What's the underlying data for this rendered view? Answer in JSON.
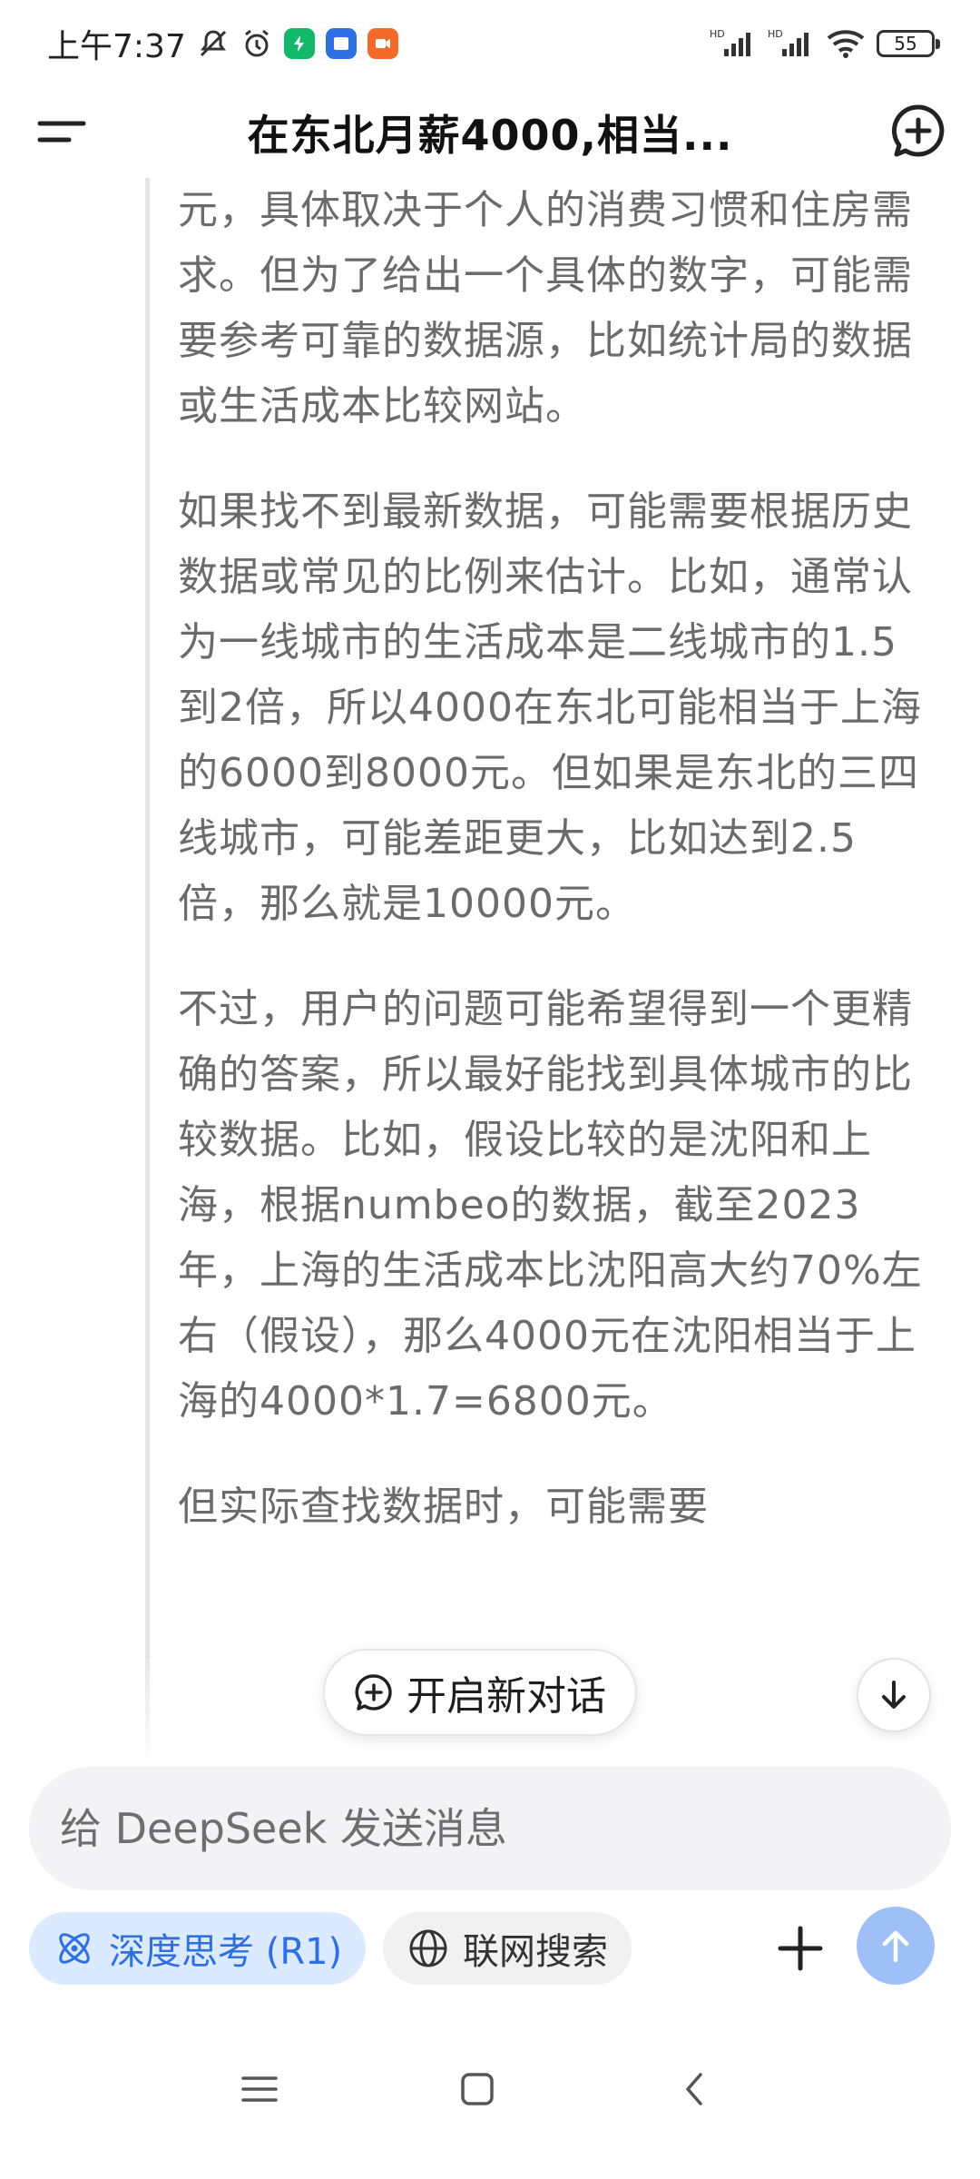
{
  "status_bar": {
    "time": "上午7:37",
    "battery": "55",
    "signal_1": "HD",
    "signal_2": "HD"
  },
  "header": {
    "title": "在东北月薪4000,相当..."
  },
  "content": {
    "paragraphs": [
      "元，具体取决于个人的消费习惯和住房需求。但为了给出一个具体的数字，可能需要参考可靠的数据源，比如统计局的数据或生活成本比较网站。",
      "如果找不到最新数据，可能需要根据历史数据或常见的比例来估计。比如，通常认为一线城市的生活成本是二线城市的1.5到2倍，所以4000在东北可能相当于上海的6000到8000元。但如果是东北的三四线城市，可能差距更大，比如达到2.5倍，那么就是10000元。",
      "不过，用户的问题可能希望得到一个更精确的答案，所以最好能找到具体城市的比较数据。比如，假设比较的是沈阳和上海，根据numbeo的数据，截至2023年，上海的生活成本比沈阳高大约70%左右（假设），那么4000元在沈阳相当于上海的4000*1.7=6800元。",
      "但实际查找数据时，可能需要"
    ]
  },
  "floating": {
    "new_conversation_label": "开启新对话"
  },
  "composer": {
    "placeholder": "给 DeepSeek 发送消息",
    "value": ""
  },
  "tools": {
    "deep_think_label": "深度思考 (R1)",
    "web_search_label": "联网搜索"
  },
  "colors": {
    "accent": "#2f6fe4",
    "deep_chip_bg": "#dbeafe",
    "send_button": "#9ec0f7",
    "thinking_text": "#6b6b6b"
  },
  "icons": {
    "menu": "menu-icon",
    "new_chat": "new-chat-icon",
    "scroll_down": "arrow-down-icon",
    "deep_think": "atom-icon",
    "web_search": "globe-icon",
    "attach": "plus-icon",
    "send": "arrow-up-icon"
  }
}
